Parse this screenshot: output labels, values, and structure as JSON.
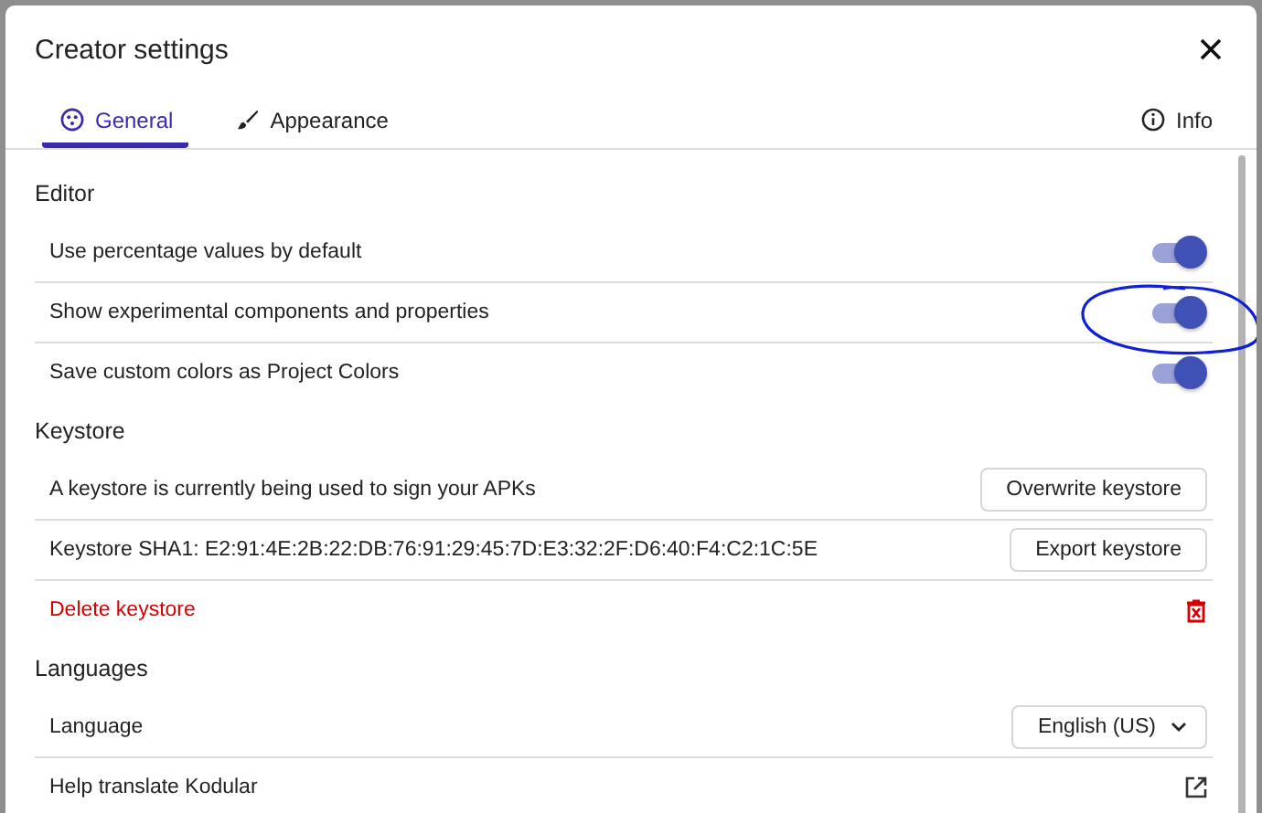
{
  "dialog": {
    "title": "Creator settings"
  },
  "tabs": [
    {
      "label": "General",
      "selected": true
    },
    {
      "label": "Appearance",
      "selected": false
    }
  ],
  "info": {
    "label": "Info"
  },
  "sections": [
    {
      "title": "Editor",
      "rows": [
        {
          "kind": "toggle",
          "label": "Use percentage values by default",
          "checked": true
        },
        {
          "kind": "toggle",
          "label": "Show experimental components and properties",
          "checked": true
        },
        {
          "kind": "toggle",
          "label": "Save custom colors as Project Colors",
          "checked": true
        }
      ]
    },
    {
      "title": "Keystore",
      "rows": [
        {
          "kind": "button",
          "label": "A keystore is currently being used to sign your APKs",
          "action": "Overwrite keystore"
        },
        {
          "kind": "button",
          "label": "Keystore SHA1: E2:91:4E:2B:22:DB:76:91:29:45:7D:E3:32:2F:D6:40:F4:C2:1C:5E",
          "action": "Export keystore"
        },
        {
          "kind": "danger",
          "label": "Delete keystore"
        }
      ]
    },
    {
      "title": "Languages",
      "rows": [
        {
          "kind": "select",
          "label": "Language",
          "value": "English (US)"
        },
        {
          "kind": "link",
          "label": "Help translate Kodular"
        }
      ]
    }
  ]
}
